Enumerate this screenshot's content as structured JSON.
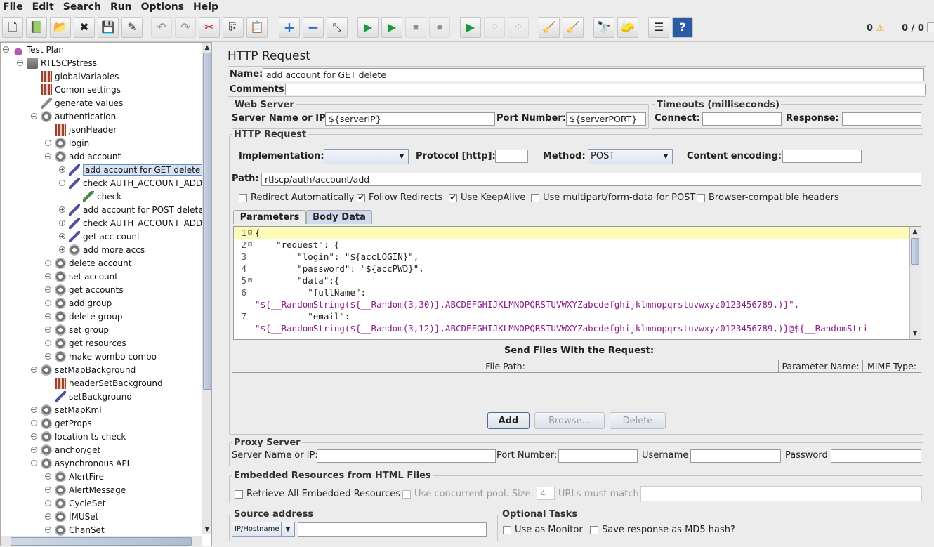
{
  "menu": [
    "File",
    "Edit",
    "Search",
    "Run",
    "Options",
    "Help"
  ],
  "toolbar": {
    "buttons": [
      {
        "name": "new-icon",
        "glyph": "🗋"
      },
      {
        "name": "templates-icon",
        "glyph": "📗"
      },
      {
        "name": "open-icon",
        "glyph": "📂"
      },
      {
        "name": "close-icon",
        "glyph": "✖"
      },
      {
        "name": "save-icon",
        "glyph": "💾"
      },
      {
        "name": "save-as-icon",
        "glyph": "✎"
      },
      {
        "name": "undo-icon",
        "glyph": "↶"
      },
      {
        "name": "redo-icon",
        "glyph": "↷"
      },
      {
        "name": "cut-icon",
        "glyph": "✂"
      },
      {
        "name": "copy-icon",
        "glyph": "⎘"
      },
      {
        "name": "paste-icon",
        "glyph": "📋"
      },
      {
        "name": "expand-icon",
        "glyph": "+"
      },
      {
        "name": "collapse-icon",
        "glyph": "−"
      },
      {
        "name": "toggle-icon",
        "glyph": "⤡"
      },
      {
        "name": "start-icon",
        "glyph": "▶"
      },
      {
        "name": "start-no-pause-icon",
        "glyph": "▶"
      },
      {
        "name": "stop-icon",
        "glyph": "⏹"
      },
      {
        "name": "shutdown-icon",
        "glyph": "⏺"
      },
      {
        "name": "remote-start-icon",
        "glyph": "▶"
      },
      {
        "name": "remote-stop-icon",
        "glyph": "⁘"
      },
      {
        "name": "remote-shutdown-icon",
        "glyph": "⁘"
      },
      {
        "name": "clear-icon",
        "glyph": "🧹"
      },
      {
        "name": "clear-all-icon",
        "glyph": "🧹"
      },
      {
        "name": "search-icon",
        "glyph": "🔭"
      },
      {
        "name": "reset-search-icon",
        "glyph": "🧽"
      },
      {
        "name": "function-helper-icon",
        "glyph": "☰"
      },
      {
        "name": "help-icon",
        "glyph": "?"
      }
    ],
    "warnings_count": "0",
    "threads": "0 / 0"
  },
  "tree": [
    {
      "label": "Test Plan",
      "icon": "flask",
      "toggle": "minus"
    },
    {
      "label": "RTLSCPstress",
      "icon": "bin",
      "toggle": "minus"
    },
    {
      "label": "globalVariables",
      "icon": "grid",
      "toggle": ""
    },
    {
      "label": "Comon settings",
      "icon": "grid",
      "toggle": ""
    },
    {
      "label": "generate values",
      "icon": "wrench",
      "toggle": ""
    },
    {
      "label": "authentication",
      "icon": "gear",
      "toggle": "minus"
    },
    {
      "label": "jsonHeader",
      "icon": "grid",
      "toggle": ""
    },
    {
      "label": "login",
      "icon": "gear",
      "toggle": "plus"
    },
    {
      "label": "add account",
      "icon": "gear",
      "toggle": "minus"
    },
    {
      "label": "add account for GET delete",
      "icon": "pen",
      "toggle": "plus",
      "selected": true
    },
    {
      "label": "check AUTH_ACCOUNT_ADDE",
      "icon": "pen",
      "toggle": "minus"
    },
    {
      "label": "check",
      "icon": "check",
      "toggle": ""
    },
    {
      "label": "add account for POST delete",
      "icon": "pen",
      "toggle": "plus"
    },
    {
      "label": "check AUTH_ACCOUNT_ADDE",
      "icon": "pen",
      "toggle": "plus"
    },
    {
      "label": "get acc count",
      "icon": "pen",
      "toggle": "plus"
    },
    {
      "label": "add more accs",
      "icon": "gear",
      "toggle": "plus"
    },
    {
      "label": "delete account",
      "icon": "gear",
      "toggle": "plus"
    },
    {
      "label": "set account",
      "icon": "gear",
      "toggle": "plus"
    },
    {
      "label": "get accounts",
      "icon": "gear",
      "toggle": "plus"
    },
    {
      "label": "add group",
      "icon": "gear",
      "toggle": "plus"
    },
    {
      "label": "delete group",
      "icon": "gear",
      "toggle": "plus"
    },
    {
      "label": "set group",
      "icon": "gear",
      "toggle": "plus"
    },
    {
      "label": "get resources",
      "icon": "gear",
      "toggle": "plus"
    },
    {
      "label": "make wombo combo",
      "icon": "gear",
      "toggle": "plus"
    },
    {
      "label": "setMapBackground",
      "icon": "gear",
      "toggle": "minus"
    },
    {
      "label": "headerSetBackground",
      "icon": "grid",
      "toggle": ""
    },
    {
      "label": "setBackground",
      "icon": "pen",
      "toggle": ""
    },
    {
      "label": "setMapKml",
      "icon": "gear",
      "toggle": "plus"
    },
    {
      "label": "getProps",
      "icon": "gear",
      "toggle": "plus"
    },
    {
      "label": "location ts check",
      "icon": "gear",
      "toggle": "plus"
    },
    {
      "label": "anchor/get",
      "icon": "gear",
      "toggle": "plus"
    },
    {
      "label": "asynchronous API",
      "icon": "gear",
      "toggle": "minus"
    },
    {
      "label": "AlertFire",
      "icon": "gear",
      "toggle": "plus"
    },
    {
      "label": "AlertMessage",
      "icon": "gear",
      "toggle": "plus"
    },
    {
      "label": "CycleSet",
      "icon": "gear",
      "toggle": "plus"
    },
    {
      "label": "IMUSet",
      "icon": "gear",
      "toggle": "plus"
    },
    {
      "label": "ChanSet",
      "icon": "gear",
      "toggle": "plus"
    }
  ],
  "panel": {
    "title": "HTTP Request",
    "name_label": "Name:",
    "name_value": "add account for GET delete",
    "comments_label": "Comments:",
    "web_server": {
      "title": "Web Server",
      "server_label": "Server Name or IP:",
      "server_value": "${serverIP}",
      "port_label": "Port Number:",
      "port_value": "${serverPORT}"
    },
    "timeouts": {
      "title": "Timeouts (milliseconds)",
      "connect_label": "Connect:",
      "response_label": "Response:"
    },
    "http_request": {
      "title": "HTTP Request",
      "impl_label": "Implementation:",
      "impl_value": "",
      "protocol_label": "Protocol [http]:",
      "protocol_value": "",
      "method_label": "Method:",
      "method_value": "POST",
      "encoding_label": "Content encoding:",
      "path_label": "Path:",
      "path_value": "rtlscp/auth/account/add"
    },
    "options": [
      {
        "label": "Redirect Automatically",
        "checked": false
      },
      {
        "label": "Follow Redirects",
        "checked": true
      },
      {
        "label": "Use KeepAlive",
        "checked": true
      },
      {
        "label": "Use multipart/form-data for POST",
        "checked": false
      },
      {
        "label": "Browser-compatible headers",
        "checked": false
      }
    ],
    "tabs": [
      "Parameters",
      "Body Data"
    ],
    "body_lines": [
      {
        "num": "1",
        "fold": "⊟",
        "code": "{"
      },
      {
        "num": "2",
        "fold": "⊟",
        "code": "    \"request\": {"
      },
      {
        "num": "3",
        "fold": "",
        "code": "        \"login\": \"${accLOGIN}\","
      },
      {
        "num": "4",
        "fold": "",
        "code": "        \"password\": \"${accPWD}\","
      },
      {
        "num": "5",
        "fold": "⊟",
        "code": "        \"data\":{"
      },
      {
        "num": "6",
        "fold": "",
        "code": "          \"fullName\":"
      },
      {
        "num": "",
        "fold": "",
        "code": "\"${__RandomString(${__Random(3,30)},ABCDEFGHIJKLMNOPQRSTUVWXYZabcdefghijklmnopqrstuvwxyz0123456789,)}\","
      },
      {
        "num": "7",
        "fold": "",
        "code": "          \"email\":"
      },
      {
        "num": "",
        "fold": "",
        "code": "\"${__RandomString(${__Random(3,12)},ABCDEFGHIJKLMNOPQRSTUVWXYZabcdefghijklmnopqrstuvwxyz0123456789,)}@${__RandomStri"
      }
    ],
    "files": {
      "title": "Send Files With the Request:",
      "col_path": "File Path:",
      "col_param": "Parameter Name:",
      "col_mime": "MIME Type:",
      "add": "Add",
      "browse": "Browse...",
      "delete": "Delete"
    },
    "proxy": {
      "title": "Proxy Server",
      "server_label": "Server Name or IP:",
      "port_label": "Port Number:",
      "user_label": "Username",
      "pass_label": "Password"
    },
    "embedded": {
      "title": "Embedded Resources from HTML Files",
      "retrieve_label": "Retrieve All Embedded Resources",
      "pool_label": "Use concurrent pool. Size:",
      "pool_value": "4",
      "match_label": "URLs must match:"
    },
    "source": {
      "title": "Source address",
      "type_value": "IP/Hostname"
    },
    "optional": {
      "title": "Optional Tasks",
      "monitor_label": "Use as Monitor",
      "md5_label": "Save response as MD5 hash?"
    }
  }
}
